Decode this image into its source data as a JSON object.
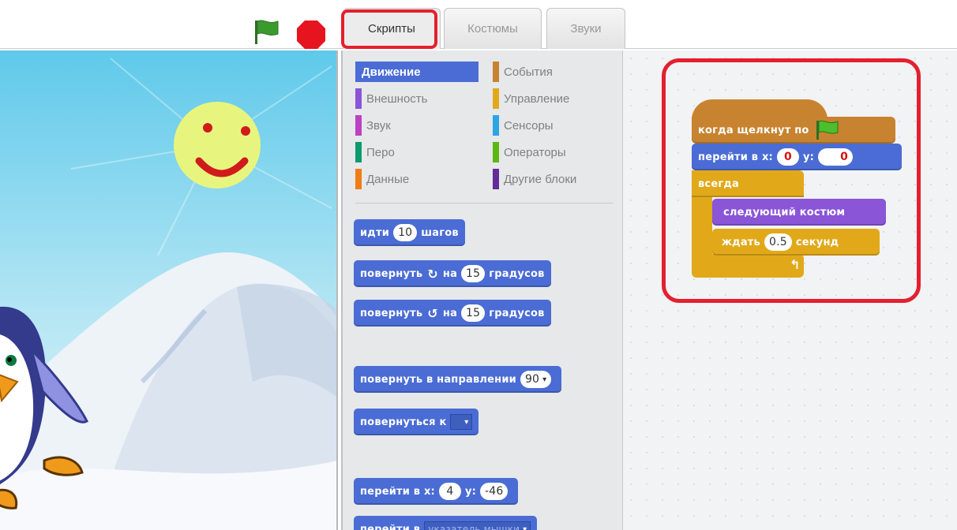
{
  "tabs": [
    {
      "label": "Скрипты",
      "active": true
    },
    {
      "label": "Костюмы",
      "active": false
    },
    {
      "label": "Звуки",
      "active": false
    }
  ],
  "categories": [
    {
      "label": "Движение",
      "color": "#4a6cd4",
      "active": true
    },
    {
      "label": "События",
      "color": "#c88330"
    },
    {
      "label": "Внешность",
      "color": "#8a55d7"
    },
    {
      "label": "Управление",
      "color": "#e1a91a"
    },
    {
      "label": "Звук",
      "color": "#bb42c3"
    },
    {
      "label": "Сенсоры",
      "color": "#2ca5e2"
    },
    {
      "label": "Перо",
      "color": "#0e9a6c"
    },
    {
      "label": "Операторы",
      "color": "#5cb712"
    },
    {
      "label": "Данные",
      "color": "#ee7d16"
    },
    {
      "label": "Другие блоки",
      "color": "#632d99"
    }
  ],
  "palette_blocks": {
    "move": {
      "pre": "идти",
      "value": "10",
      "post": "шагов"
    },
    "turn_right": {
      "pre": "повернуть",
      "mid": "на",
      "value": "15",
      "post": "градусов"
    },
    "turn_left": {
      "pre": "повернуть",
      "mid": "на",
      "value": "15",
      "post": "градусов"
    },
    "point_direction": {
      "pre": "повернуть в направлении",
      "value": "90"
    },
    "point_towards": {
      "pre": "повернуться к"
    },
    "goto_xy": {
      "pre": "перейти в x:",
      "x": "4",
      "ylabel": "y:",
      "y": "-46"
    },
    "goto_target": {
      "pre": "перейти в",
      "target": "указатель мышки"
    }
  },
  "script": {
    "hat": "когда щелкнут по",
    "goto_pre": "перейти в x:",
    "goto_x": "0",
    "goto_ylabel": "y:",
    "goto_y": "0",
    "forever": "всегда",
    "next_costume": "следующий костюм",
    "wait_pre": "ждать",
    "wait_value": "0.5",
    "wait_post": "секунд"
  },
  "colors": {
    "highlight": "#e3202f",
    "green_flag": "#3a9a2e",
    "stop": "#e6141e"
  }
}
